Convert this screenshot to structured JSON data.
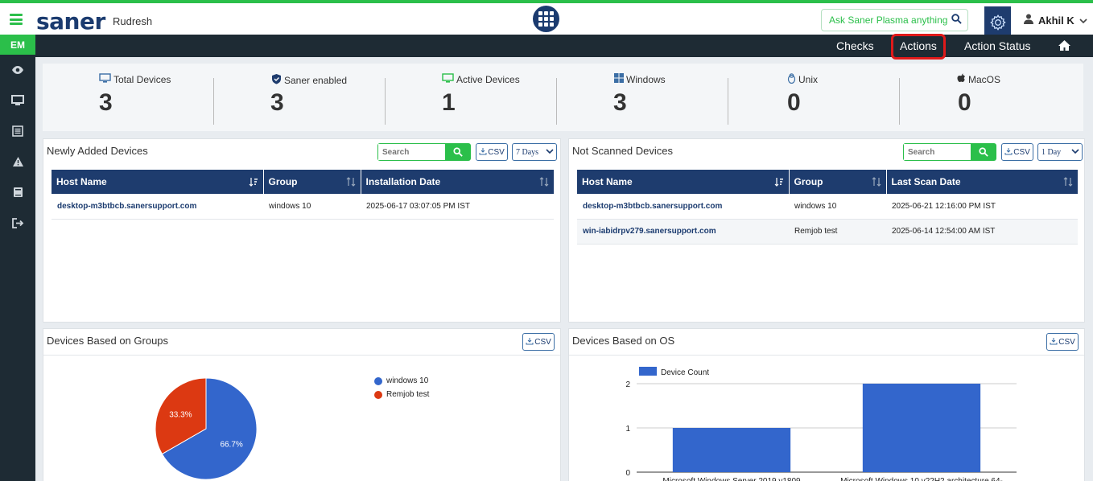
{
  "header": {
    "logo": "saner",
    "org": "Rudresh",
    "ask_placeholder": "Ask Saner Plasma anything !",
    "user": "Akhil K"
  },
  "sidebar": {
    "badge": "EM"
  },
  "subnav": {
    "items": [
      "Checks",
      "Actions",
      "Action Status"
    ]
  },
  "stats": [
    {
      "label": "Total Devices",
      "value": "3"
    },
    {
      "label": "Saner enabled",
      "value": "3"
    },
    {
      "label": "Active Devices",
      "value": "1"
    },
    {
      "label": "Windows",
      "value": "3"
    },
    {
      "label": "Unix",
      "value": "0"
    },
    {
      "label": "MacOS",
      "value": "0"
    }
  ],
  "newly_added": {
    "title": "Newly Added Devices",
    "search_placeholder": "Search",
    "csv": "CSV",
    "days": "7 Days",
    "columns": [
      "Host Name",
      "Group",
      "Installation Date"
    ],
    "rows": [
      [
        "desktop-m3btbcb.sanersupport.com",
        "windows 10",
        "2025-06-17 03:07:05 PM IST"
      ]
    ]
  },
  "not_scanned": {
    "title": "Not Scanned Devices",
    "search_placeholder": "Search",
    "csv": "CSV",
    "days": "1 Day",
    "columns": [
      "Host Name",
      "Group",
      "Last Scan Date"
    ],
    "rows": [
      [
        "desktop-m3btbcb.sanersupport.com",
        "windows 10",
        "2025-06-21 12:16:00 PM IST"
      ],
      [
        "win-iabidrpv279.sanersupport.com",
        "Remjob test",
        "2025-06-14 12:54:00 AM IST"
      ]
    ]
  },
  "groups_panel": {
    "title": "Devices Based on Groups",
    "csv": "CSV"
  },
  "os_panel": {
    "title": "Devices Based on OS",
    "csv": "CSV"
  },
  "chart_data": [
    {
      "type": "pie",
      "slices": [
        {
          "name": "windows 10",
          "value": 66.7,
          "label": "66.7%",
          "color": "#3366cc"
        },
        {
          "name": "Remjob test",
          "value": 33.3,
          "label": "33.3%",
          "color": "#dc3912"
        }
      ],
      "legend": "right"
    },
    {
      "type": "bar",
      "categories": [
        "Microsoft Windows Server 2019 v1809",
        "Microsoft Windows 10 v22H2 architecture 64-"
      ],
      "series": [
        {
          "name": "Device Count",
          "values": [
            1,
            2
          ],
          "color": "#3366cc"
        }
      ],
      "yticks": [
        "0",
        "1",
        "2"
      ],
      "ylim": [
        0,
        2
      ],
      "legend": "top-left"
    }
  ]
}
